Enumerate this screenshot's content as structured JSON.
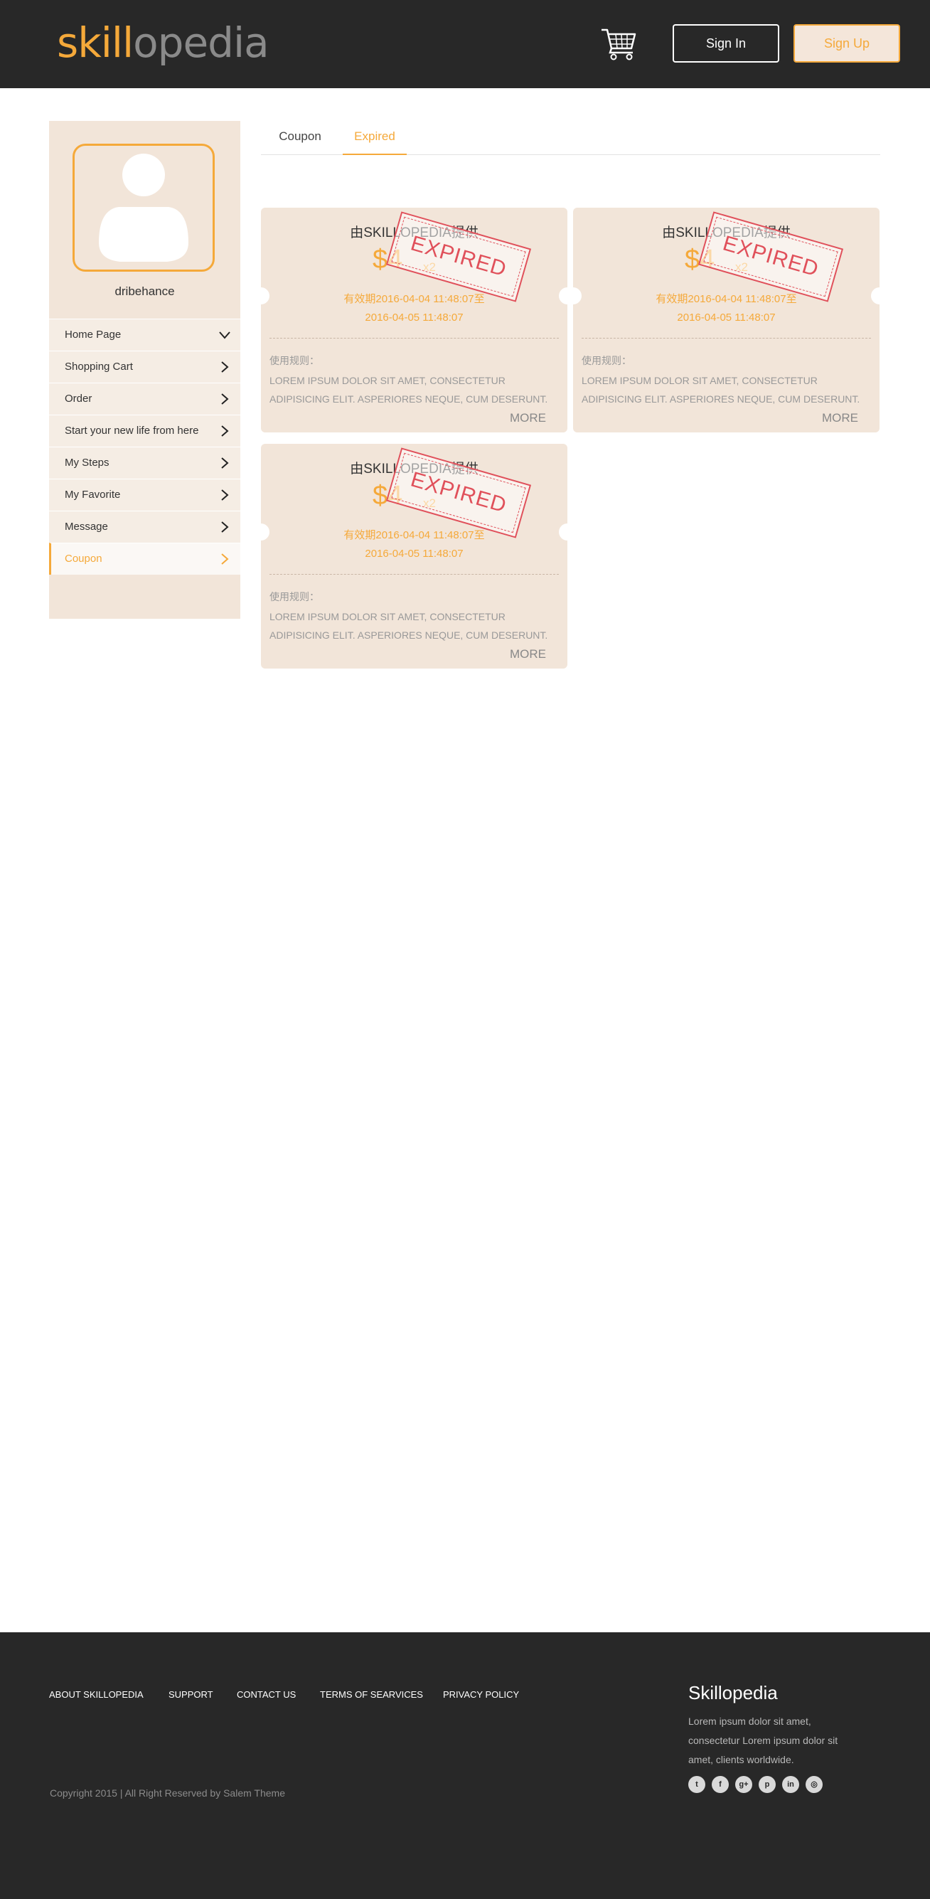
{
  "header": {
    "logo_part1": "skill",
    "logo_part2": "opedia",
    "cart_icon": "shopping-cart-icon",
    "signin_label": "Sign In",
    "signup_label": "Sign Up"
  },
  "colors": {
    "accent": "#f5a93a",
    "header_bg": "#282828",
    "sidebar_bg": "#f2e5d9",
    "stamp": "#e0505a"
  },
  "sidebar": {
    "username": "dribehance",
    "items": [
      {
        "label": "Home Page",
        "icon": "chevron-down-icon"
      },
      {
        "label": "Shopping Cart",
        "icon": "chevron-right-icon"
      },
      {
        "label": "Order",
        "icon": "chevron-right-icon"
      },
      {
        "label": "Start your new life from here",
        "icon": "chevron-right-icon"
      },
      {
        "label": "My Steps",
        "icon": "chevron-right-icon"
      },
      {
        "label": "My Favorite",
        "icon": "chevron-right-icon"
      },
      {
        "label": "Message",
        "icon": "chevron-right-icon"
      },
      {
        "label": "Coupon",
        "icon": "chevron-right-icon",
        "active": true
      }
    ]
  },
  "tabs": [
    {
      "label": "Coupon"
    },
    {
      "label": "Expired",
      "active": true
    }
  ],
  "coupons": [
    {
      "provider": "由SKILLOPEDIA提供",
      "amount": "$4",
      "quantity": "x2",
      "validity_line1": "有效期2016-04-04 11:48:07至",
      "validity_line2": "2016-04-05 11:48:07",
      "rules_title": "使用规则：",
      "rules_text": "LOREM IPSUM DOLOR SIT AMET, CONSECTETUR ADIPISICING ELIT. ASPERIORES NEQUE, CUM DESERUNT. SED TEMPORE",
      "more": "MORE",
      "stamp": "EXPIRED"
    },
    {
      "provider": "由SKILLOPEDIA提供",
      "amount": "$4",
      "quantity": "x2",
      "validity_line1": "有效期2016-04-04 11:48:07至",
      "validity_line2": "2016-04-05 11:48:07",
      "rules_title": "使用规则：",
      "rules_text": "LOREM IPSUM DOLOR SIT AMET, CONSECTETUR ADIPISICING ELIT. ASPERIORES NEQUE, CUM DESERUNT. SED TEMPORE",
      "more": "MORE",
      "stamp": "EXPIRED"
    },
    {
      "provider": "由SKILLOPEDIA提供",
      "amount": "$4",
      "quantity": "x2",
      "validity_line1": "有效期2016-04-04 11:48:07至",
      "validity_line2": "2016-04-05 11:48:07",
      "rules_title": "使用规则：",
      "rules_text": "LOREM IPSUM DOLOR SIT AMET, CONSECTETUR ADIPISICING ELIT. ASPERIORES NEQUE, CUM DESERUNT. SED TEMPORE",
      "more": "MORE",
      "stamp": "EXPIRED"
    }
  ],
  "footer": {
    "links": [
      "ABOUT SKILLOPEDIA",
      "SUPPORT",
      "CONTACT US",
      "TERMS OF SEARVICES",
      "PRIVACY POLICY"
    ],
    "copyright": "Copyright 2015 | All Right Reserved by Salem Theme",
    "brand": "Skillopedia",
    "description": "Lorem ipsum dolor sit amet, consectetur Lorem ipsum dolor sit amet,  clients worldwide.",
    "socials": [
      {
        "icon": "twitter-icon",
        "glyph": "t"
      },
      {
        "icon": "facebook-icon",
        "glyph": "f"
      },
      {
        "icon": "google-plus-icon",
        "glyph": "g+"
      },
      {
        "icon": "pinterest-icon",
        "glyph": "p"
      },
      {
        "icon": "linkedin-icon",
        "glyph": "in"
      },
      {
        "icon": "dribbble-icon",
        "glyph": "◎"
      }
    ]
  }
}
